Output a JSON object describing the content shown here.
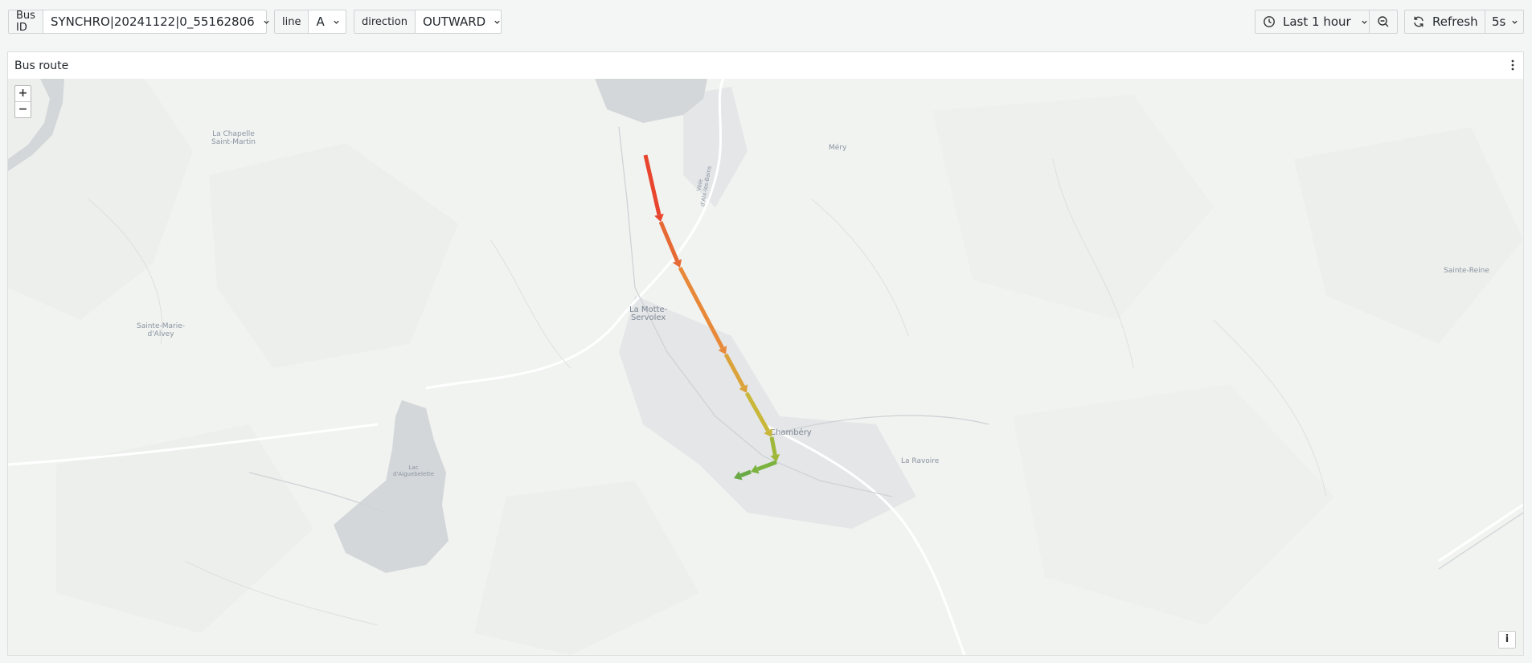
{
  "toolbar": {
    "bus_id": {
      "label": "Bus ID",
      "value": "SYNCHRO|20241122|0_55162806"
    },
    "line": {
      "label": "line",
      "value": "A"
    },
    "direction": {
      "label": "direction",
      "value": "OUTWARD"
    },
    "time_range": "Last 1 hour",
    "refresh_label": "Refresh",
    "refresh_interval": "5s"
  },
  "panel": {
    "title": "Bus route",
    "zoom_in": "+",
    "zoom_out": "−",
    "info": "i"
  },
  "map": {
    "places": {
      "la_chapelle": "La Chapelle\nSaint-Martin",
      "mery": "Méry",
      "sainte_reine": "Sainte-Reine",
      "la_motte": "La Motte-\nServolex",
      "sainte_marie": "Sainte-Marie-\nd'Alvey",
      "chambery": "Chambéry",
      "la_ravoire": "La Ravoire",
      "lac": "Lac\nd'Aiguebelette",
      "voie": "Voie\nd'Aix-les-Bains"
    },
    "route_colors": [
      "#e8452f",
      "#e66a34",
      "#e8893a",
      "#dca33a",
      "#c9b73a",
      "#9fb83a",
      "#7cb33f",
      "#6aaa46"
    ]
  }
}
